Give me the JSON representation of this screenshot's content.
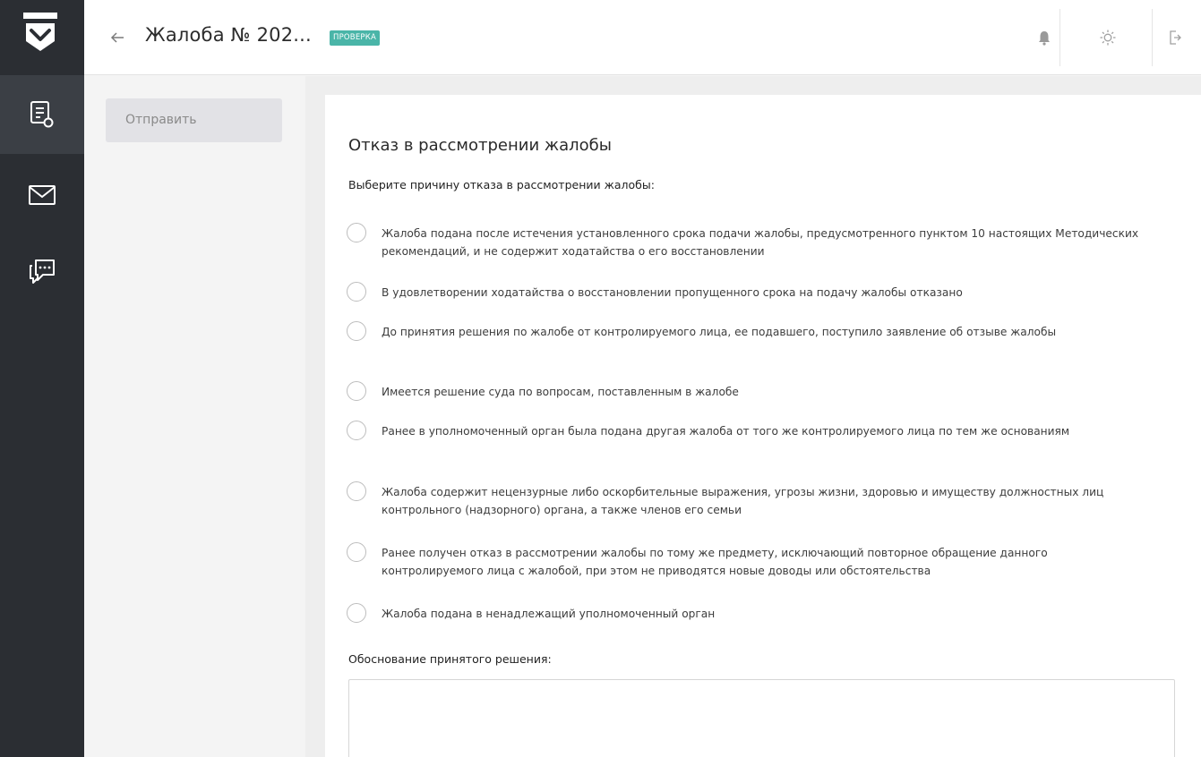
{
  "rail": {
    "logo_icon": "shield-download-icon",
    "items": [
      {
        "icon": "document-search-icon",
        "active": true
      },
      {
        "icon": "mail-icon",
        "active": false
      },
      {
        "icon": "chat-icon",
        "active": false
      }
    ]
  },
  "header": {
    "title": "Жалоба № 202...",
    "status": "ПРОВЕРКА",
    "icons": [
      "bell-icon",
      "sun-icon",
      "logout-icon"
    ]
  },
  "actions": {
    "send_label": "Отправить"
  },
  "form": {
    "title": "Отказ в рассмотрении жалобы",
    "subtitle": "Выберите причину отказа в рассмотрении жалобы:",
    "options": [
      "Жалоба подана после истечения установленного срока подачи жалобы, предусмотренного пунктом 10 настоящих Методических рекомендаций, и не содержит ходатайства о его восстановлении",
      "В удовлетворении ходатайства о восстановлении пропущенного срока на подачу жалобы отказано",
      "До принятия решения по жалобе от контролируемого лица, ее подавшего, поступило заявление об отзыве жалобы",
      "Имеется решение суда по вопросам, поставленным в жалобе",
      "Ранее в уполномоченный орган была подана другая жалоба от того же контролируемого лица по тем же основаниям",
      "Жалоба содержит нецензурные либо оскорбительные выражения, угрозы жизни, здоровью и имуществу должностных лиц контрольного (надзорного) органа, а также членов его семьи",
      "Ранее получен отказ в рассмотрении жалобы по тому же предмету, исключающий повторное обращение данного контролируемого лица с жалобой, при этом не приводятся новые доводы или обстоятельства",
      "Жалоба подана в ненадлежащий уполномоченный орган"
    ],
    "justification_label": "Обоснование принятого решения:",
    "justification_value": ""
  },
  "colors": {
    "rail_bg": "#2b2e33",
    "rail_active": "#3b3f45",
    "badge": "#4ab5a8"
  }
}
